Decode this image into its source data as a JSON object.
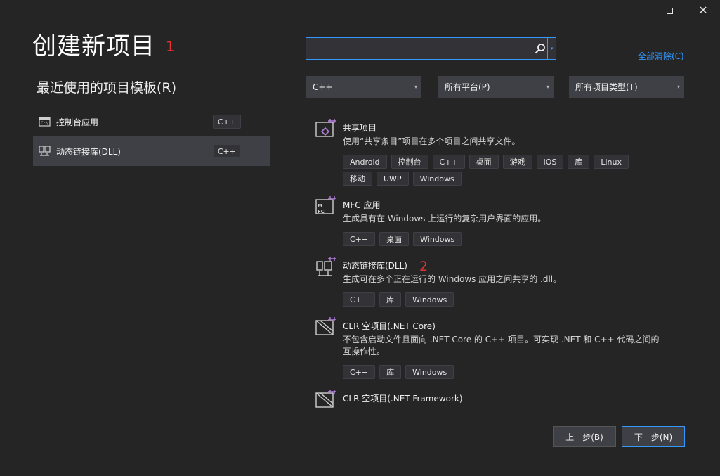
{
  "window": {
    "maximize_icon": "maximize-icon",
    "close_icon": "close-icon",
    "close_glyph": "✕"
  },
  "title": "创建新项目",
  "annotations": {
    "a1": "1",
    "a2": "2"
  },
  "recent": {
    "heading": "最近使用的项目模板(R)",
    "items": [
      {
        "label": "控制台应用",
        "lang": "C++",
        "icon": "console-app-icon",
        "selected": false
      },
      {
        "label": "动态链接库(DLL)",
        "lang": "C++",
        "icon": "dll-icon",
        "selected": true
      }
    ]
  },
  "search": {
    "value": "",
    "placeholder": "",
    "icon": "search-icon",
    "dropdown_glyph": "▾"
  },
  "clear_all": "全部清除(C)",
  "filters": {
    "language": "C++",
    "platform": "所有平台(P)",
    "type": "所有项目类型(T)",
    "caret": "▾"
  },
  "templates": [
    {
      "title": "共享项目",
      "desc": "使用“共享条目”项目在多个项目之间共享文件。",
      "tags": [
        "Android",
        "控制台",
        "C++",
        "桌面",
        "游戏",
        "iOS",
        "库",
        "Linux",
        "移动",
        "UWP",
        "Windows"
      ],
      "icon": "shared-project-icon"
    },
    {
      "title": "MFC 应用",
      "desc": "生成具有在 Windows 上运行的复杂用户界面的应用。",
      "tags": [
        "C++",
        "桌面",
        "Windows"
      ],
      "icon": "mfc-app-icon"
    },
    {
      "title": "动态链接库(DLL)",
      "desc": "生成可在多个正在运行的 Windows 应用之间共享的 .dll。",
      "tags": [
        "C++",
        "库",
        "Windows"
      ],
      "icon": "dll-template-icon"
    },
    {
      "title": "CLR 空项目(.NET Core)",
      "desc": "不包含启动文件且面向 .NET Core 的 C++ 项目。可实现 .NET 和 C++ 代码之间的互操作性。",
      "tags": [
        "C++",
        "库",
        "Windows"
      ],
      "icon": "clr-project-icon"
    },
    {
      "title": "CLR 空项目(.NET Framework)",
      "desc": "",
      "tags": [],
      "icon": "clr-framework-icon"
    }
  ],
  "buttons": {
    "back": "上一步(B)",
    "next": "下一步(N)"
  },
  "colors": {
    "accent": "#3399ff",
    "background": "#252526",
    "selected": "#3f3f46",
    "annotation": "#e8322f"
  }
}
